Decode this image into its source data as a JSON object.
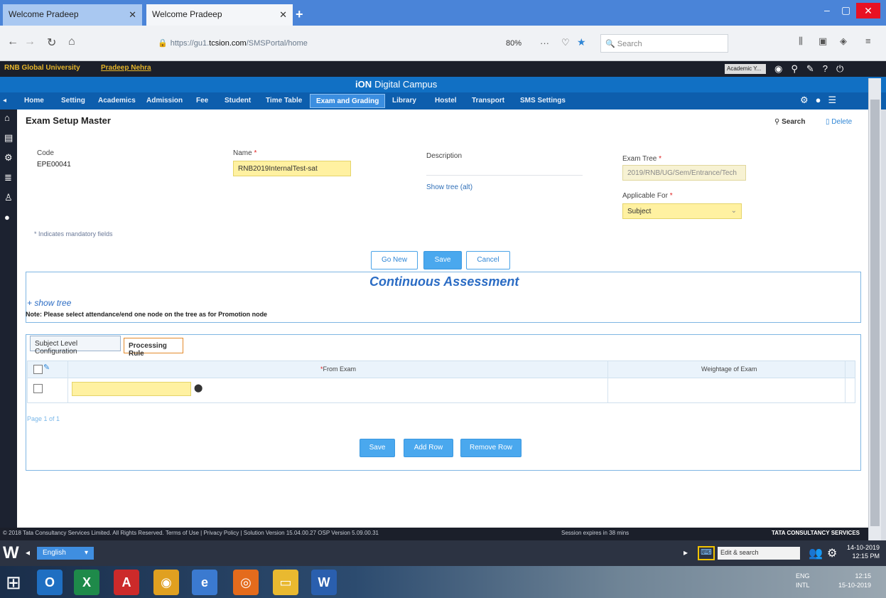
{
  "browser": {
    "tabs": [
      {
        "title": "Welcome Pradeep"
      },
      {
        "title": "Welcome Pradeep"
      }
    ],
    "url": {
      "prefix": "https://gu1.",
      "host": "tcsion.com",
      "path": "/SMSPortal/home"
    },
    "zoom": "80%",
    "search_placeholder": "Search"
  },
  "app": {
    "university": "RNB Global University",
    "user": "Pradeep Nehra",
    "academic_year": "Academic Y...",
    "brand_bold": "iON",
    "brand_rest": "Digital Campus",
    "menu": [
      "Home",
      "Setting",
      "Academics",
      "Admission",
      "Fee",
      "Student",
      "Time Table",
      "Exam and Grading",
      "Library",
      "Hostel",
      "Transport",
      "SMS Settings"
    ],
    "active_menu": "Exam and Grading"
  },
  "page": {
    "title": "Exam Setup Master",
    "search_label": "Search",
    "delete_label": "Delete",
    "code_label": "Code",
    "code_value": "EPE00041",
    "name_label": "Name",
    "name_value": "RNB2019InternalTest-sat",
    "description_label": "Description",
    "show_tree_label": "Show tree (alt)",
    "exam_tree_label": "Exam Tree",
    "exam_tree_value": "2019/RNB/UG/Sem/Entrance/Tech",
    "applicable_for_label": "Applicable For",
    "applicable_for_value": "Subject",
    "mandatory_note": "* Indicates mandatory fields",
    "buttons": {
      "new": "Go New",
      "save": "Save",
      "cancel": "Cancel"
    }
  },
  "assessment": {
    "title": "Continuous  Assessment",
    "show_tree": "+ show tree",
    "note": "Note: Please select attendance/end one node on the tree as for Promotion node"
  },
  "config": {
    "tabs": [
      "Subject Level Configuration",
      "Processing Rule"
    ],
    "columns": {
      "from_exam": "From Exam",
      "weightage": "Weightage of Exam"
    },
    "pager": "Page 1 of 1",
    "buttons": {
      "save": "Save",
      "add_row": "Add Row",
      "remove_row": "Remove Row"
    }
  },
  "footer": {
    "copyright": "© 2018 Tata Consultancy Services Limited. All Rights Reserved.   Terms of Use  |  Privacy Policy  |  Solution Version 15.04.00.27  OSP Version 5.09.00.31",
    "session": "Session expires in 38 mins",
    "company": "TATA CONSULTANCY SERVICES"
  },
  "taskbar": {
    "language": "English",
    "search": "Edit & search",
    "time1": "14-10-2019",
    "time2": "12:15 PM",
    "lang_code": "ENG",
    "region": "INTL",
    "tray_time": "12:15",
    "tray_date": "15-10-2019"
  }
}
